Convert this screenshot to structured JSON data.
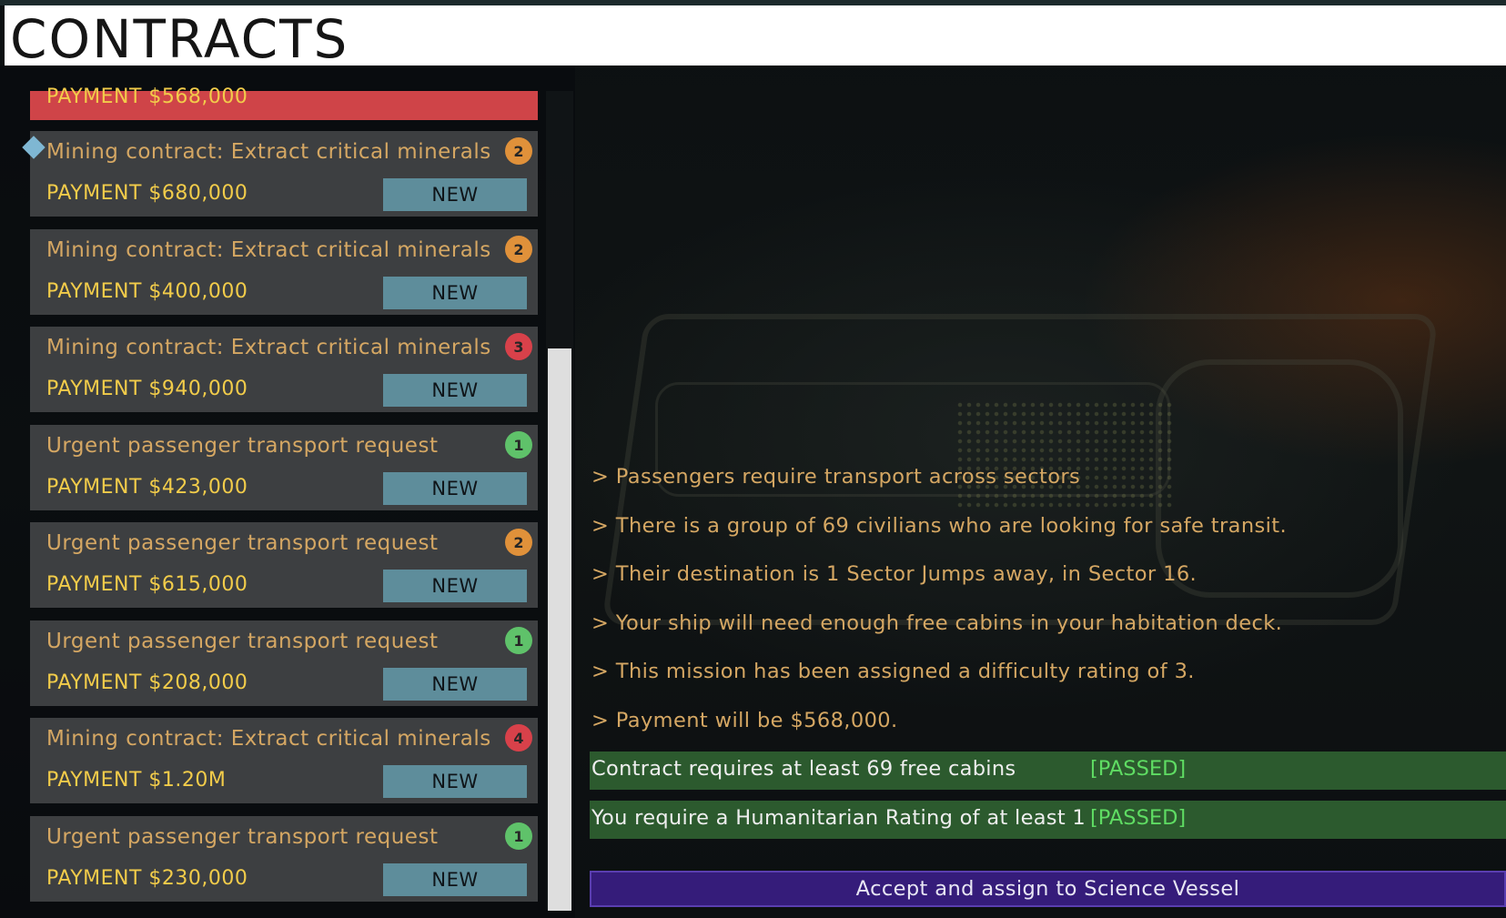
{
  "header": {
    "title": "CONTRACTS"
  },
  "selected": {
    "payment": "PAYMENT  $568,000"
  },
  "contracts": [
    {
      "title": "Mining  contract:  Extract  critical  minerals",
      "payment": "PAYMENT  $680,000",
      "badge": "NEW",
      "difficulty": "2",
      "difficulty_color": "#e0913a"
    },
    {
      "title": "Mining  contract:  Extract  critical  minerals",
      "payment": "PAYMENT  $400,000",
      "badge": "NEW",
      "difficulty": "2",
      "difficulty_color": "#e0913a"
    },
    {
      "title": "Mining  contract:  Extract  critical  minerals",
      "payment": "PAYMENT  $940,000",
      "badge": "NEW",
      "difficulty": "3",
      "difficulty_color": "#d8414a"
    },
    {
      "title": "Urgent  passenger  transport  request",
      "payment": "PAYMENT  $423,000",
      "badge": "NEW",
      "difficulty": "1",
      "difficulty_color": "#5fc26a"
    },
    {
      "title": "Urgent  passenger  transport  request",
      "payment": "PAYMENT  $615,000",
      "badge": "NEW",
      "difficulty": "2",
      "difficulty_color": "#e0913a"
    },
    {
      "title": "Urgent  passenger  transport  request",
      "payment": "PAYMENT  $208,000",
      "badge": "NEW",
      "difficulty": "1",
      "difficulty_color": "#5fc26a"
    },
    {
      "title": "Mining  contract:  Extract  critical  minerals",
      "payment": "PAYMENT  $1.20M",
      "badge": "NEW",
      "difficulty": "4",
      "difficulty_color": "#d8414a"
    },
    {
      "title": "Urgent  passenger  transport  request",
      "payment": "PAYMENT  $230,000",
      "badge": "NEW",
      "difficulty": "1",
      "difficulty_color": "#5fc26a"
    }
  ],
  "details": {
    "lines": [
      ">  Passengers  require  transport  across  sectors",
      ">  There  is  a  group  of  69  civilians  who  are  looking  for  safe  transit.",
      ">  Their  destination  is  1  Sector  Jumps  away,  in  Sector  16.",
      ">  Your  ship  will  need  enough  free  cabins  in  your  habitation  deck.",
      ">  This  mission  has  been  assigned  a  difficulty  rating  of  3.",
      ">  Payment  will  be  $568,000."
    ],
    "requirements": [
      {
        "text": "Contract  requires  at  least  69  free  cabins",
        "status": "[PASSED]"
      },
      {
        "text": "You  require  a  Humanitarian  Rating  of  at  least  1",
        "status": "[PASSED]"
      }
    ],
    "accept_label": "Accept  and  assign  to  Science  Vessel"
  },
  "colors": {
    "selected": "#cf4448",
    "card_bg": "#3d3f41",
    "title_text": "#d5a763",
    "payment_text": "#f2cc4a",
    "new_badge": "#5e8d9b",
    "passed_bar": "#2c5a2e",
    "passed_text": "#5fdc63",
    "accept_button": "#351c7a"
  }
}
